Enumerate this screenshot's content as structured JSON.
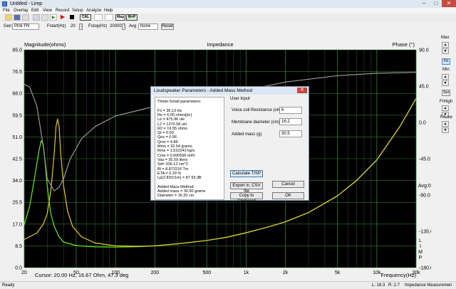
{
  "app": {
    "title": "Untitled - Limp"
  },
  "window_buttons": [
    "–",
    "□",
    "✕"
  ],
  "menu": [
    "File",
    "Overlay",
    "Edit",
    "View",
    "Record",
    "Setup",
    "Analyze",
    "Help"
  ],
  "toolbar": {
    "cal": "CAL",
    "mag": "Mag",
    "mp": "M+P"
  },
  "gen": {
    "gen_label": "Gen",
    "gen_value": "Pink FN",
    "fstart_label": "Fstart(Hz)",
    "fstart_value": "20",
    "fstop_label": "Fstop(Hz)",
    "fstop_value": "20000",
    "avg_label": "Avg",
    "avg_value": "None",
    "reset": "Reset"
  },
  "chart": {
    "left_title": "Magnitude(ohms)",
    "center_title": "Impedance",
    "right_title": "Phase (°)",
    "x_title": "Frequency(Hz)",
    "cursor": "Cursor: 20.00 Hz, 16.67 Ohm, 47.3 deg",
    "avg_marker": "Avg:0.0",
    "vertical_tag": [
      "L",
      "I",
      "M",
      "P"
    ]
  },
  "chart_data": {
    "type": "line",
    "title": "Impedance",
    "xlabel": "Frequency(Hz)",
    "ylabel": "Magnitude(ohms)",
    "y2label": "Phase (°)",
    "xscale": "log",
    "xlim": [
      20,
      20000
    ],
    "ylim": [
      0,
      85
    ],
    "y2lim": [
      -180,
      90
    ],
    "x_ticks": [
      "20",
      "50",
      "100",
      "200",
      "500",
      "1k",
      "2k",
      "5k",
      "10k",
      "20k"
    ],
    "x_tick_values": [
      20,
      50,
      100,
      200,
      500,
      1000,
      2000,
      5000,
      10000,
      20000
    ],
    "y_ticks": [
      "85.0",
      "76.5",
      "68.0",
      "59.5",
      "51.0",
      "42.5",
      "34.0",
      "25.5",
      "17.0",
      "8.5",
      "0.0"
    ],
    "y2_ticks": [
      "90.0",
      "45.0",
      "0.0",
      "-45.0",
      "-90.0",
      "-135.0",
      "-180.0"
    ],
    "grid": true,
    "colors": {
      "background": "#000000",
      "grid": "#2f5a2f",
      "major_grid": "#3a7a3a"
    },
    "series": [
      {
        "axis": "left",
        "color": "#66ee22",
        "x": [
          20,
          22,
          24,
          26,
          27,
          28,
          29,
          30,
          31,
          32,
          34,
          37,
          40,
          50,
          70,
          100,
          150,
          200,
          300,
          500,
          700,
          1000,
          1500,
          2000,
          3000,
          5000,
          7000,
          10000,
          15000,
          20000
        ],
        "y": [
          16.7,
          24,
          35,
          46,
          49.5,
          48,
          40,
          32,
          26,
          21,
          16,
          12,
          10,
          8.6,
          8.1,
          8.0,
          8.2,
          8.5,
          9.3,
          10.6,
          11.8,
          13.6,
          16.0,
          17.9,
          21.5,
          28.0,
          34.0,
          42.0,
          55.0,
          66.0
        ]
      },
      {
        "axis": "left",
        "color": "#e6c92e",
        "x": [
          20,
          25,
          28,
          30,
          32,
          34,
          35,
          36,
          37,
          38,
          40,
          43,
          47,
          55,
          70,
          100,
          150,
          200,
          300,
          500,
          700,
          1000,
          1500,
          2000,
          3000,
          5000,
          7000,
          10000,
          15000,
          20000
        ],
        "y": [
          11,
          13.5,
          17,
          21,
          30,
          45,
          55,
          58,
          55,
          45,
          32,
          22,
          16,
          12,
          9.6,
          8.5,
          8.3,
          8.5,
          9.3,
          10.6,
          11.8,
          13.6,
          16.0,
          17.9,
          21.5,
          28.0,
          34.0,
          42.0,
          55.0,
          66.0
        ]
      },
      {
        "axis": "right",
        "color": "#9a9a9a",
        "x": [
          20,
          22,
          25,
          28,
          30,
          34,
          37,
          40,
          45,
          55,
          70,
          100,
          150,
          200,
          300,
          500,
          1000,
          2000,
          5000,
          10000,
          20000
        ],
        "y": [
          47.3,
          44,
          20,
          -30,
          -70,
          -85,
          -80,
          -70,
          -45,
          -20,
          -5,
          8,
          15,
          20,
          24,
          30,
          40,
          50,
          58,
          61,
          62
        ]
      }
    ]
  },
  "side_panel": {
    "max": "Max",
    "fit": "Fit",
    "min": "Min",
    "set": "Set",
    "frhigh": "FrHigh",
    "frlow": "FrLow"
  },
  "dialog": {
    "title": "Loudspeaker Parameters - Added Mass Method",
    "close": "✕",
    "ts_lines": [
      "Thiele-Small parameters:",
      "",
      "Fs  =  36.13 Hz",
      "Re  =  6.00 ohms[dc]",
      "Le  =  475.96 uH",
      "L2  =  1270.58 uH",
      "R2  =  19.55 ohms",
      "Qt  =  0.50",
      "Qes  =  0.56",
      "Qms  =  4.89",
      "Mms  =  32.54 grams",
      "Rms  =  1.510243 kg/s",
      "Cms  =  0.000596 m/N",
      "Vas  =  35.59 liters",
      "Sd=  206.12 cm^2",
      "Bl  =  8.872216 Tm",
      "ETA  =  0.29 %",
      "Lp(2.83V/1m)  =  87.93 dB",
      "",
      "Added Mass Method:",
      "Added mass = 30.50 grams",
      "Diameter = 16.20 cm"
    ],
    "user_input_label": "User Input",
    "voice_coil_label": "Voice coil Resistance (ohms)",
    "voice_coil_value": "6",
    "membrane_label": "Membrane diameter (cm)",
    "membrane_value": "16.2",
    "added_mass_label": "Added mass (g)",
    "added_mass_value": "30.5",
    "calc_button": "Calculate T/SP",
    "export_button": "Export in .CSV file",
    "cancel_button": "Cancel",
    "copy_button": "Copy to Clipboard",
    "ok_button": "OK"
  },
  "status": {
    "ready": "Ready",
    "l_value": "L: 18.3",
    "r_value": "R: 2.7",
    "mode": "Impedance Measuremen"
  }
}
